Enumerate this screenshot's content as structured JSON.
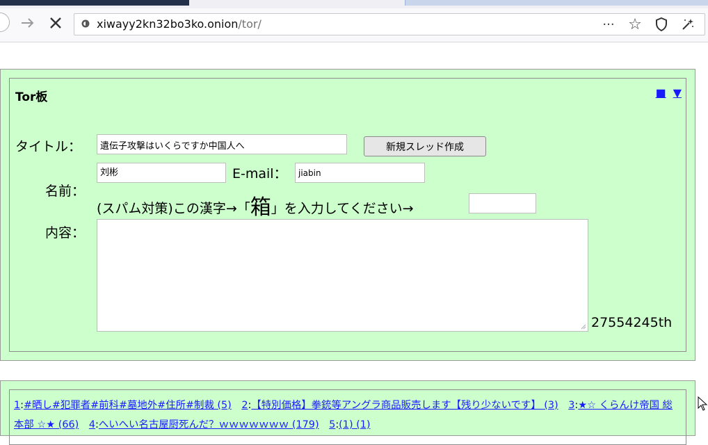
{
  "browser": {
    "url_host": "xiwayy2kn32bo3ko.onion",
    "url_path": "/tor/",
    "icons": [
      "back-arrow-icon",
      "forward-arrow-icon",
      "close-icon",
      "onion-site-icon",
      "more-dots-icon",
      "bookmark-star-icon",
      "shield-icon",
      "magic-wand-icon"
    ],
    "more_label": "···",
    "star_label": "☆"
  },
  "board": {
    "title": "Tor板",
    "nav_square": "■",
    "nav_down": "▼",
    "title_label": "タイトル：",
    "title_value": "遺伝子攻撃はいくらですか中国人へ",
    "create_button": "新規スレッド作成",
    "name_label": "名前：",
    "name_value": "刘彬",
    "email_label": "E-mail：",
    "email_value": "jiabin",
    "captcha_prefix": "(スパム対策)この漢字→「",
    "captcha_kanji": "箱",
    "captcha_suffix": "」を入力してください→",
    "captcha_value": "",
    "content_label": "内容：",
    "content_value": "",
    "counter": "27554245th"
  },
  "threads": [
    {
      "num": "1",
      "title": "#晒し#犯罪者#前科#墓地外#住所#制裁 (5)"
    },
    {
      "num": "2",
      "title": "【特別価格】拳銃等アングラ商品販売します【残り少ないです】 (3)"
    },
    {
      "num": "3",
      "title": "★☆ くらんけ帝国 総本部 ☆★ (66)"
    },
    {
      "num": "4",
      "title": "へいへい名古屋厨死んだ？ｗｗｗｗｗｗｗ (179)"
    },
    {
      "num": "5",
      "title": "(1) (1)"
    }
  ],
  "colors": {
    "panel_bg": "#ccffcc",
    "link": "#1a1aff"
  }
}
